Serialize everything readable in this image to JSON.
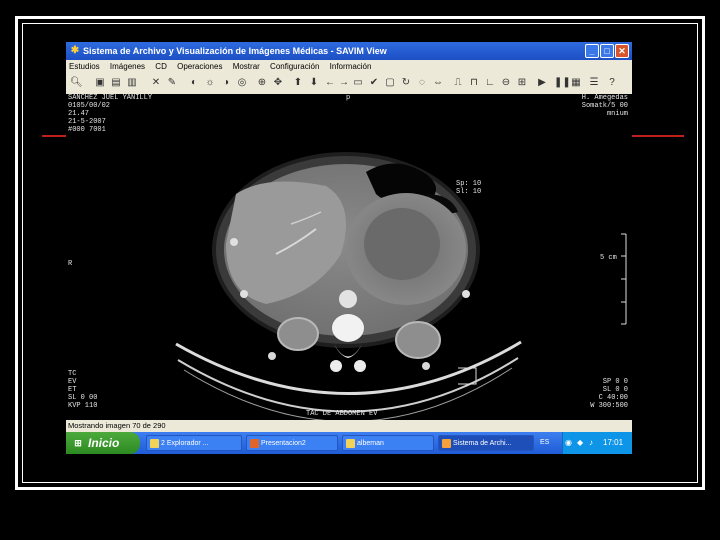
{
  "window": {
    "title": "Sistema de Archivo y Visualización de Imágenes Médicas - SAVIM View",
    "app_icon": "savim-logo-icon",
    "controls": {
      "minimize": "_",
      "maximize": "□",
      "close": "✕"
    }
  },
  "menu": [
    "Estudios",
    "Imágenes",
    "CD",
    "Operaciones",
    "Mostrar",
    "Configuración",
    "Información"
  ],
  "overlays": {
    "top_left": [
      "SANCHEZ JUEL YANILLY",
      "0105/00/02",
      "21.47",
      "21-5-2007",
      "#000 7001"
    ],
    "top_center": "p",
    "top_right": [
      "H. Amegedas",
      "Somatk/5 00",
      "mnium"
    ],
    "slice_info": [
      "Sp: 10",
      "Sl: 10"
    ],
    "left_marker": "R",
    "right_marker": "5 cm",
    "bottom_left": [
      "TC",
      "EV",
      "ET",
      "SL 0 00",
      "KVP 110"
    ],
    "bottom_center": "TAC DE ABDOMEN EV",
    "bottom_right": [
      "SP 0 0",
      "SL 0 0",
      "C 40:00",
      "W 300:500"
    ]
  },
  "status": "Mostrando imagen 70 de 290",
  "taskbar": {
    "start_label": "Inicio",
    "tasks": [
      "2 Explorador ...",
      "Presentacion2",
      "albeman",
      "Sistema de Archi..."
    ],
    "tray_extra": "ES",
    "time": "17:01"
  }
}
